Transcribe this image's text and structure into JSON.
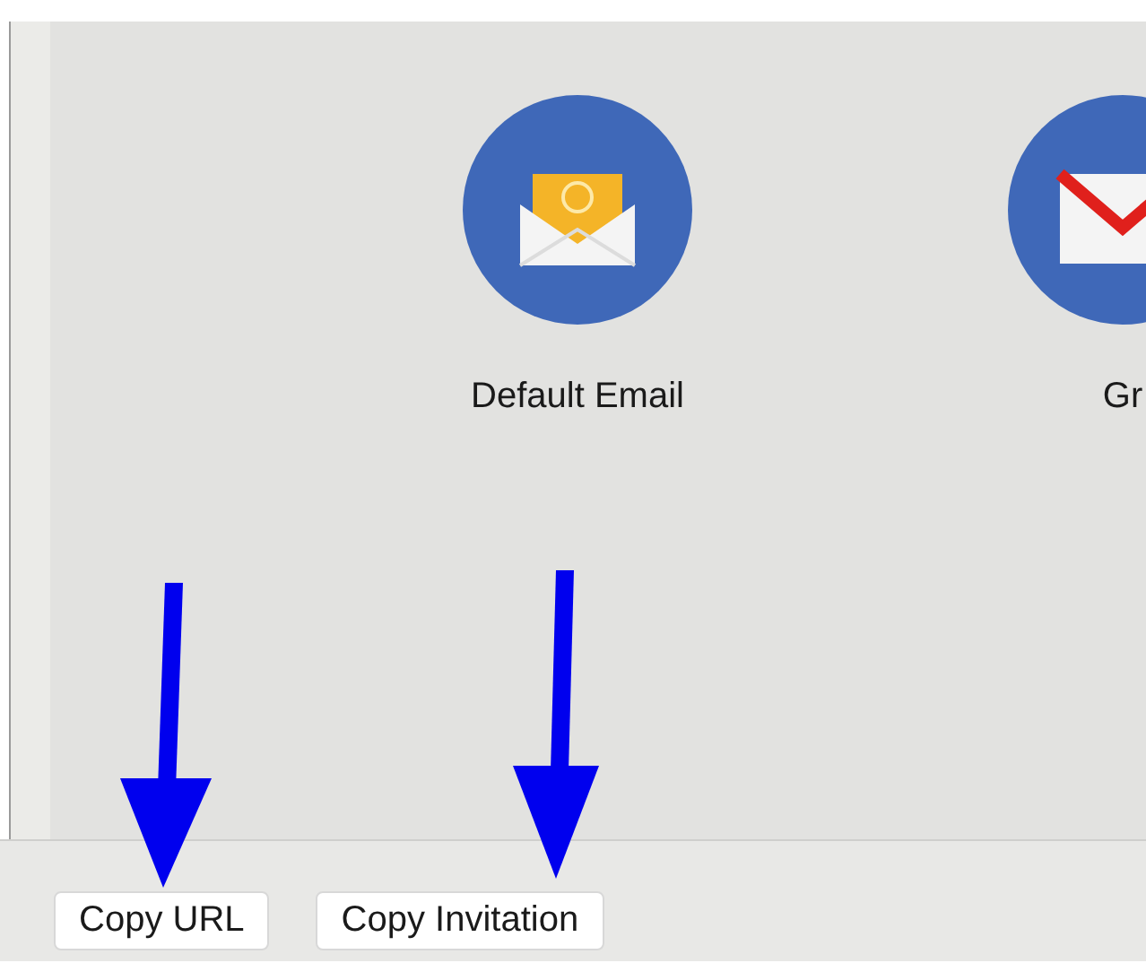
{
  "apps": [
    {
      "kind": "email",
      "label": "Default Email"
    },
    {
      "kind": "gmail",
      "label": "Gr"
    }
  ],
  "buttons": [
    "Copy URL",
    "Copy Invitation"
  ]
}
